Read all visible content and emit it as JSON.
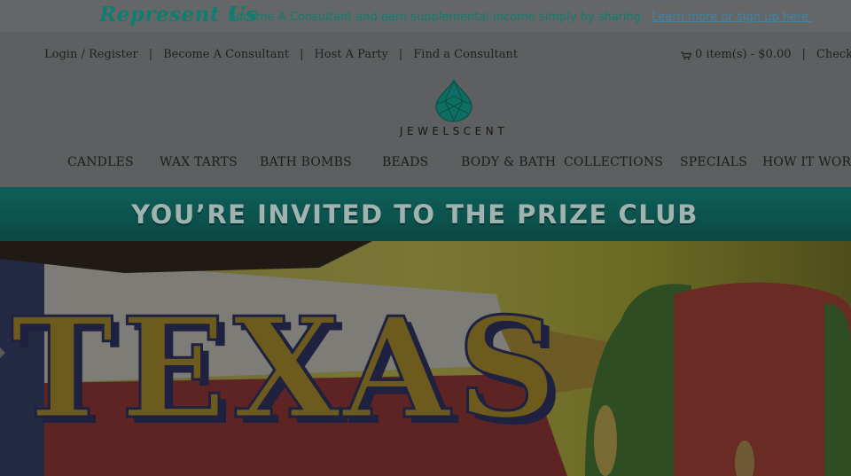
{
  "promo": {
    "brand": "Represent Us",
    "message": "Become A Consultant and earn supplemental income simply by sharing.",
    "link_label": "Learn more or sign up here."
  },
  "utility_nav": {
    "items": [
      {
        "label": "Login / Register"
      },
      {
        "label": "Become A Consultant"
      },
      {
        "label": "Host A Party"
      },
      {
        "label": "Find a Consultant"
      }
    ],
    "separator": "|"
  },
  "cart": {
    "summary": "0 item(s) - $0.00",
    "checkout_label": "Checkout"
  },
  "logo": {
    "text": "JEWELSCENT"
  },
  "main_nav": {
    "items": [
      {
        "label": "CANDLES"
      },
      {
        "label": "WAX TARTS"
      },
      {
        "label": "BATH BOMBS"
      },
      {
        "label": "BEADS"
      },
      {
        "label": "BODY & BATH"
      },
      {
        "label": "COLLECTIONS"
      },
      {
        "label": "SPECIALS"
      },
      {
        "label": "HOW IT WORKS"
      }
    ]
  },
  "prize_banner": {
    "text": "YOU’RE INVITED TO THE PRIZE CLUB"
  },
  "hero": {
    "headline": "TEXAS"
  },
  "colors": {
    "overlay_bg": "#5b5d5e",
    "teal": "#0f7d70",
    "link": "#3d86a8",
    "banner_teal": "#0f5f59"
  }
}
